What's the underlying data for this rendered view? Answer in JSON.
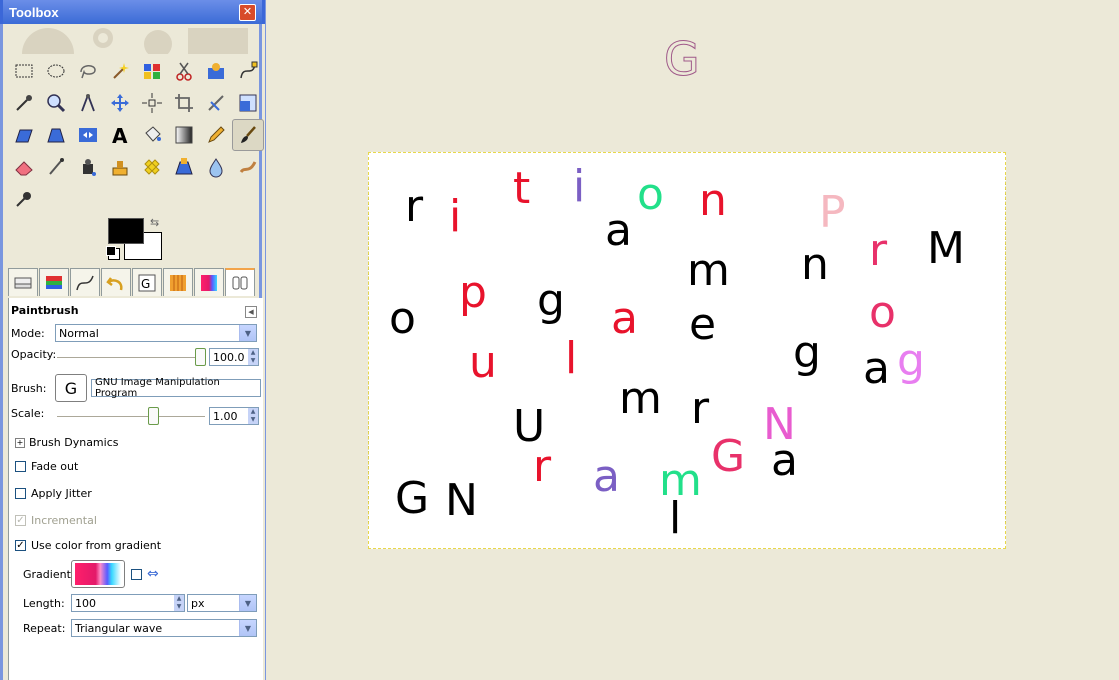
{
  "window": {
    "title": "Toolbox",
    "close": "✕"
  },
  "tools": [
    "rect-select-icon",
    "ellipse-select-icon",
    "lasso-icon",
    "fuzzy-select-icon",
    "color-select-icon",
    "scissors-icon",
    "foreground-select-icon",
    "paths-icon",
    "color-picker-icon",
    "zoom-icon",
    "measure-icon",
    "move-icon",
    "align-icon",
    "crop-icon",
    "rotate-icon",
    "scale-icon",
    "shear-icon",
    "perspective-icon",
    "flip-icon",
    "text-icon",
    "bucket-fill-icon",
    "blend-icon",
    "pencil-icon",
    "paintbrush-icon",
    "eraser-icon",
    "airbrush-icon",
    "ink-icon",
    "clone-icon",
    "heal-icon",
    "perspective-clone-icon",
    "blur-icon",
    "smudge-icon",
    "dodge-burn-icon"
  ],
  "tabs": [
    "layers-tab",
    "channels-tab",
    "paths-tab",
    "undo-tab",
    "brushes-tab",
    "patterns-tab",
    "gradients-tab",
    "tool-options-tab"
  ],
  "options": {
    "title": "Paintbrush",
    "mode_label": "Mode:",
    "mode_value": "Normal",
    "opacity_label": "Opacity:",
    "opacity_value": "100.0",
    "brush_label": "Brush:",
    "brush_name": "GNU Image Manipulation Program",
    "brush_glyph": "G",
    "scale_label": "Scale:",
    "scale_value": "1.00",
    "brush_dynamics": "Brush Dynamics",
    "fade_out": "Fade out",
    "apply_jitter": "Apply Jitter",
    "incremental": "Incremental",
    "use_color_gradient": "Use color from gradient",
    "gradient_label": "Gradient:",
    "length_label": "Length:",
    "length_value": "100",
    "length_unit": "px",
    "repeat_label": "Repeat:",
    "repeat_value": "Triangular wave"
  },
  "floating_glyph": "G",
  "letters": [
    {
      "ch": "r",
      "color": "#000000"
    },
    {
      "ch": "i",
      "color": "#e8132c"
    },
    {
      "ch": "t",
      "color": "#e8132c"
    },
    {
      "ch": "i",
      "color": "#7b5fc4"
    },
    {
      "ch": "a",
      "color": "#000000"
    },
    {
      "ch": "o",
      "color": "#22e08a"
    },
    {
      "ch": "n",
      "color": "#e8132c"
    },
    {
      "ch": "P",
      "color": "#f5b8c0"
    },
    {
      "ch": "r",
      "color": "#e8316a"
    },
    {
      "ch": "M",
      "color": "#000000"
    },
    {
      "ch": "n",
      "color": "#000000"
    },
    {
      "ch": "m",
      "color": "#000000"
    },
    {
      "ch": "o",
      "color": "#000000"
    },
    {
      "ch": "p",
      "color": "#e8132c"
    },
    {
      "ch": "g",
      "color": "#000000"
    },
    {
      "ch": "a",
      "color": "#e8132c"
    },
    {
      "ch": "e",
      "color": "#000000"
    },
    {
      "ch": "o",
      "color": "#e8316a"
    },
    {
      "ch": "g",
      "color": "#000000"
    },
    {
      "ch": "a",
      "color": "#000000"
    },
    {
      "ch": "g",
      "color": "#e87ef0"
    },
    {
      "ch": "u",
      "color": "#e8132c"
    },
    {
      "ch": "l",
      "color": "#e8132c"
    },
    {
      "ch": "m",
      "color": "#000000"
    },
    {
      "ch": "r",
      "color": "#000000"
    },
    {
      "ch": "U",
      "color": "#000000"
    },
    {
      "ch": "N",
      "color": "#e85ccf"
    },
    {
      "ch": "r",
      "color": "#e8132c"
    },
    {
      "ch": "a",
      "color": "#7b5fc4"
    },
    {
      "ch": "m",
      "color": "#22e08a"
    },
    {
      "ch": "G",
      "color": "#e8316a"
    },
    {
      "ch": "a",
      "color": "#000000"
    },
    {
      "ch": "l",
      "color": "#000000"
    },
    {
      "ch": "G",
      "color": "#000000"
    },
    {
      "ch": "N",
      "color": "#000000"
    }
  ]
}
